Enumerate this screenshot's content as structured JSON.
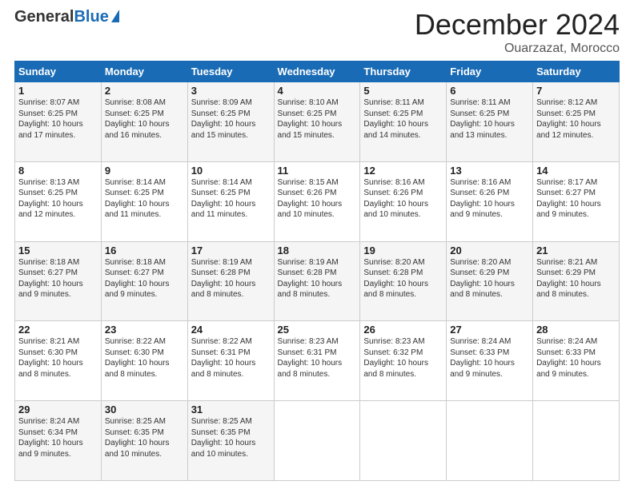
{
  "logo": {
    "general": "General",
    "blue": "Blue"
  },
  "header": {
    "month": "December 2024",
    "location": "Ouarzazat, Morocco"
  },
  "weekdays": [
    "Sunday",
    "Monday",
    "Tuesday",
    "Wednesday",
    "Thursday",
    "Friday",
    "Saturday"
  ],
  "weeks": [
    [
      {
        "day": "1",
        "sunrise": "Sunrise: 8:07 AM",
        "sunset": "Sunset: 6:25 PM",
        "daylight": "Daylight: 10 hours and 17 minutes."
      },
      {
        "day": "2",
        "sunrise": "Sunrise: 8:08 AM",
        "sunset": "Sunset: 6:25 PM",
        "daylight": "Daylight: 10 hours and 16 minutes."
      },
      {
        "day": "3",
        "sunrise": "Sunrise: 8:09 AM",
        "sunset": "Sunset: 6:25 PM",
        "daylight": "Daylight: 10 hours and 15 minutes."
      },
      {
        "day": "4",
        "sunrise": "Sunrise: 8:10 AM",
        "sunset": "Sunset: 6:25 PM",
        "daylight": "Daylight: 10 hours and 15 minutes."
      },
      {
        "day": "5",
        "sunrise": "Sunrise: 8:11 AM",
        "sunset": "Sunset: 6:25 PM",
        "daylight": "Daylight: 10 hours and 14 minutes."
      },
      {
        "day": "6",
        "sunrise": "Sunrise: 8:11 AM",
        "sunset": "Sunset: 6:25 PM",
        "daylight": "Daylight: 10 hours and 13 minutes."
      },
      {
        "day": "7",
        "sunrise": "Sunrise: 8:12 AM",
        "sunset": "Sunset: 6:25 PM",
        "daylight": "Daylight: 10 hours and 12 minutes."
      }
    ],
    [
      {
        "day": "8",
        "sunrise": "Sunrise: 8:13 AM",
        "sunset": "Sunset: 6:25 PM",
        "daylight": "Daylight: 10 hours and 12 minutes."
      },
      {
        "day": "9",
        "sunrise": "Sunrise: 8:14 AM",
        "sunset": "Sunset: 6:25 PM",
        "daylight": "Daylight: 10 hours and 11 minutes."
      },
      {
        "day": "10",
        "sunrise": "Sunrise: 8:14 AM",
        "sunset": "Sunset: 6:25 PM",
        "daylight": "Daylight: 10 hours and 11 minutes."
      },
      {
        "day": "11",
        "sunrise": "Sunrise: 8:15 AM",
        "sunset": "Sunset: 6:26 PM",
        "daylight": "Daylight: 10 hours and 10 minutes."
      },
      {
        "day": "12",
        "sunrise": "Sunrise: 8:16 AM",
        "sunset": "Sunset: 6:26 PM",
        "daylight": "Daylight: 10 hours and 10 minutes."
      },
      {
        "day": "13",
        "sunrise": "Sunrise: 8:16 AM",
        "sunset": "Sunset: 6:26 PM",
        "daylight": "Daylight: 10 hours and 9 minutes."
      },
      {
        "day": "14",
        "sunrise": "Sunrise: 8:17 AM",
        "sunset": "Sunset: 6:27 PM",
        "daylight": "Daylight: 10 hours and 9 minutes."
      }
    ],
    [
      {
        "day": "15",
        "sunrise": "Sunrise: 8:18 AM",
        "sunset": "Sunset: 6:27 PM",
        "daylight": "Daylight: 10 hours and 9 minutes."
      },
      {
        "day": "16",
        "sunrise": "Sunrise: 8:18 AM",
        "sunset": "Sunset: 6:27 PM",
        "daylight": "Daylight: 10 hours and 9 minutes."
      },
      {
        "day": "17",
        "sunrise": "Sunrise: 8:19 AM",
        "sunset": "Sunset: 6:28 PM",
        "daylight": "Daylight: 10 hours and 8 minutes."
      },
      {
        "day": "18",
        "sunrise": "Sunrise: 8:19 AM",
        "sunset": "Sunset: 6:28 PM",
        "daylight": "Daylight: 10 hours and 8 minutes."
      },
      {
        "day": "19",
        "sunrise": "Sunrise: 8:20 AM",
        "sunset": "Sunset: 6:28 PM",
        "daylight": "Daylight: 10 hours and 8 minutes."
      },
      {
        "day": "20",
        "sunrise": "Sunrise: 8:20 AM",
        "sunset": "Sunset: 6:29 PM",
        "daylight": "Daylight: 10 hours and 8 minutes."
      },
      {
        "day": "21",
        "sunrise": "Sunrise: 8:21 AM",
        "sunset": "Sunset: 6:29 PM",
        "daylight": "Daylight: 10 hours and 8 minutes."
      }
    ],
    [
      {
        "day": "22",
        "sunrise": "Sunrise: 8:21 AM",
        "sunset": "Sunset: 6:30 PM",
        "daylight": "Daylight: 10 hours and 8 minutes."
      },
      {
        "day": "23",
        "sunrise": "Sunrise: 8:22 AM",
        "sunset": "Sunset: 6:30 PM",
        "daylight": "Daylight: 10 hours and 8 minutes."
      },
      {
        "day": "24",
        "sunrise": "Sunrise: 8:22 AM",
        "sunset": "Sunset: 6:31 PM",
        "daylight": "Daylight: 10 hours and 8 minutes."
      },
      {
        "day": "25",
        "sunrise": "Sunrise: 8:23 AM",
        "sunset": "Sunset: 6:31 PM",
        "daylight": "Daylight: 10 hours and 8 minutes."
      },
      {
        "day": "26",
        "sunrise": "Sunrise: 8:23 AM",
        "sunset": "Sunset: 6:32 PM",
        "daylight": "Daylight: 10 hours and 8 minutes."
      },
      {
        "day": "27",
        "sunrise": "Sunrise: 8:24 AM",
        "sunset": "Sunset: 6:33 PM",
        "daylight": "Daylight: 10 hours and 9 minutes."
      },
      {
        "day": "28",
        "sunrise": "Sunrise: 8:24 AM",
        "sunset": "Sunset: 6:33 PM",
        "daylight": "Daylight: 10 hours and 9 minutes."
      }
    ],
    [
      {
        "day": "29",
        "sunrise": "Sunrise: 8:24 AM",
        "sunset": "Sunset: 6:34 PM",
        "daylight": "Daylight: 10 hours and 9 minutes."
      },
      {
        "day": "30",
        "sunrise": "Sunrise: 8:25 AM",
        "sunset": "Sunset: 6:35 PM",
        "daylight": "Daylight: 10 hours and 10 minutes."
      },
      {
        "day": "31",
        "sunrise": "Sunrise: 8:25 AM",
        "sunset": "Sunset: 6:35 PM",
        "daylight": "Daylight: 10 hours and 10 minutes."
      },
      null,
      null,
      null,
      null
    ]
  ]
}
